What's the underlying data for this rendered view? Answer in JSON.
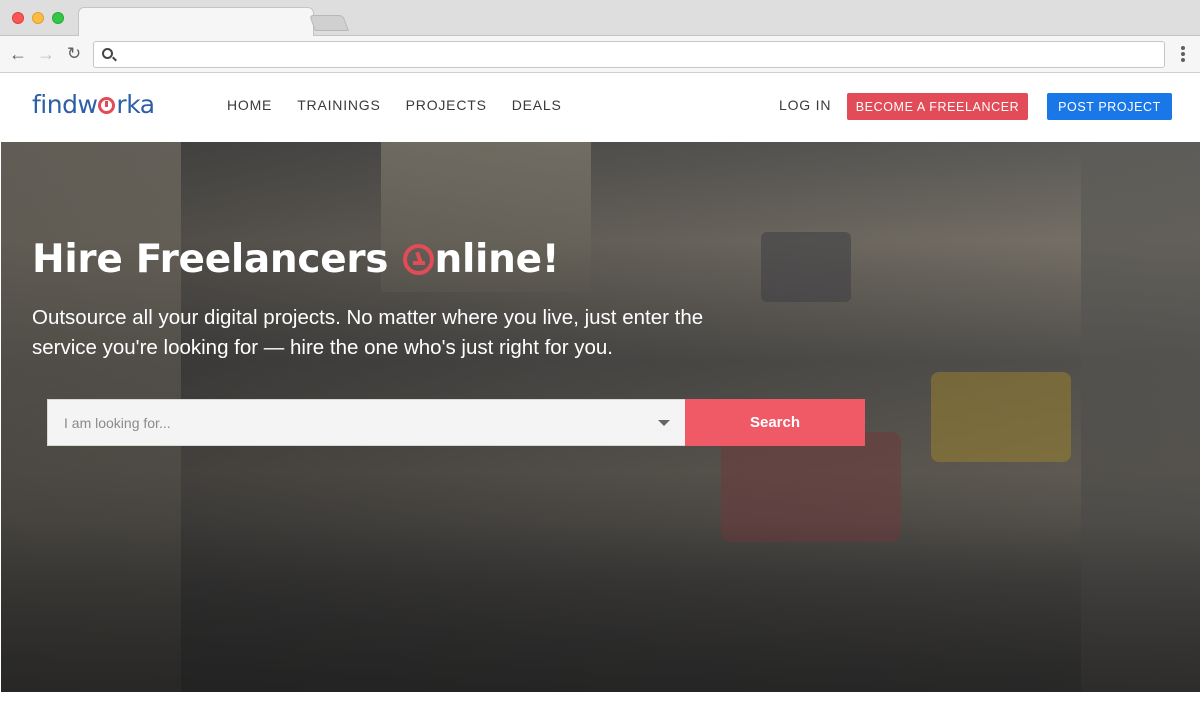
{
  "browser": {
    "url": "",
    "back_icon": "←",
    "forward_icon": "→",
    "reload_icon": "↻"
  },
  "site": {
    "logo_prefix": "findw",
    "logo_suffix": "rka",
    "nav": [
      "HOME",
      "TRAININGS",
      "PROJECTS",
      "DEALS"
    ],
    "login": "LOG IN",
    "become_freelancer": "BECOME A FREELANCER",
    "post_project": "POST PROJECT"
  },
  "hero": {
    "headline_pre": "Hire Freelancers ",
    "headline_post": "nline!",
    "subtitle": "Outsource all your digital projects. No matter where you live, just enter the service you're looking for — hire the one who's just right for you.",
    "search_placeholder": "I am looking for...",
    "search_button": "Search"
  },
  "colors": {
    "brand_blue": "#2d5fa6",
    "accent_red": "#e24b58",
    "cta_blue": "#1977e8",
    "search_button": "#f05a66"
  },
  "icons": {
    "url_bar": "search-icon",
    "menu": "kebab-menu-icon",
    "dropdown": "caret-down-icon"
  }
}
